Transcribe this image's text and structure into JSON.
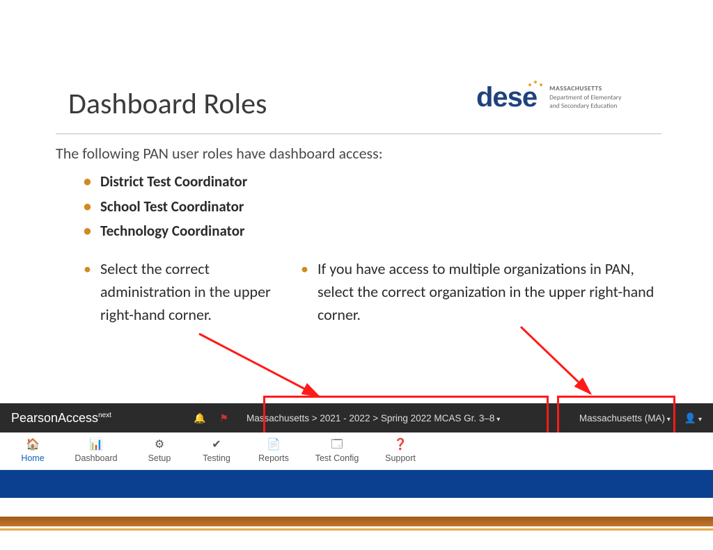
{
  "title": "Dashboard Roles",
  "logo": {
    "brand": "dese",
    "line1": "MASSACHUSETTS",
    "line2": "Department of Elementary",
    "line3": "and Secondary Education"
  },
  "intro": "The following PAN user roles have dashboard access:",
  "roles": [
    "District Test Coordinator",
    "School Test Coordinator",
    "Technology Coordinator"
  ],
  "left_point": "Select the correct administration in the upper right-hand corner.",
  "right_point": "If you have access to multiple organizations in PAN, select the correct organization in the upper right-hand corner.",
  "pan": {
    "brand_main": "PearsonAccess",
    "brand_sup": "next",
    "admin_breadcrumb": "Massachusetts > 2021 - 2022 > Spring 2022 MCAS Gr. 3–8",
    "org": "Massachusetts (MA)",
    "nav": [
      {
        "icon": "🏠",
        "label": "Home",
        "active": true
      },
      {
        "icon": "📊",
        "label": "Dashboard",
        "active": false
      },
      {
        "icon": "⚙",
        "label": "Setup",
        "active": false
      },
      {
        "icon": "✔",
        "label": "Testing",
        "active": false
      },
      {
        "icon": "📄",
        "label": "Reports",
        "active": false
      },
      {
        "icon": "🗔",
        "label": "Test Config",
        "active": false
      },
      {
        "icon": "❓",
        "label": "Support",
        "active": false
      }
    ]
  }
}
